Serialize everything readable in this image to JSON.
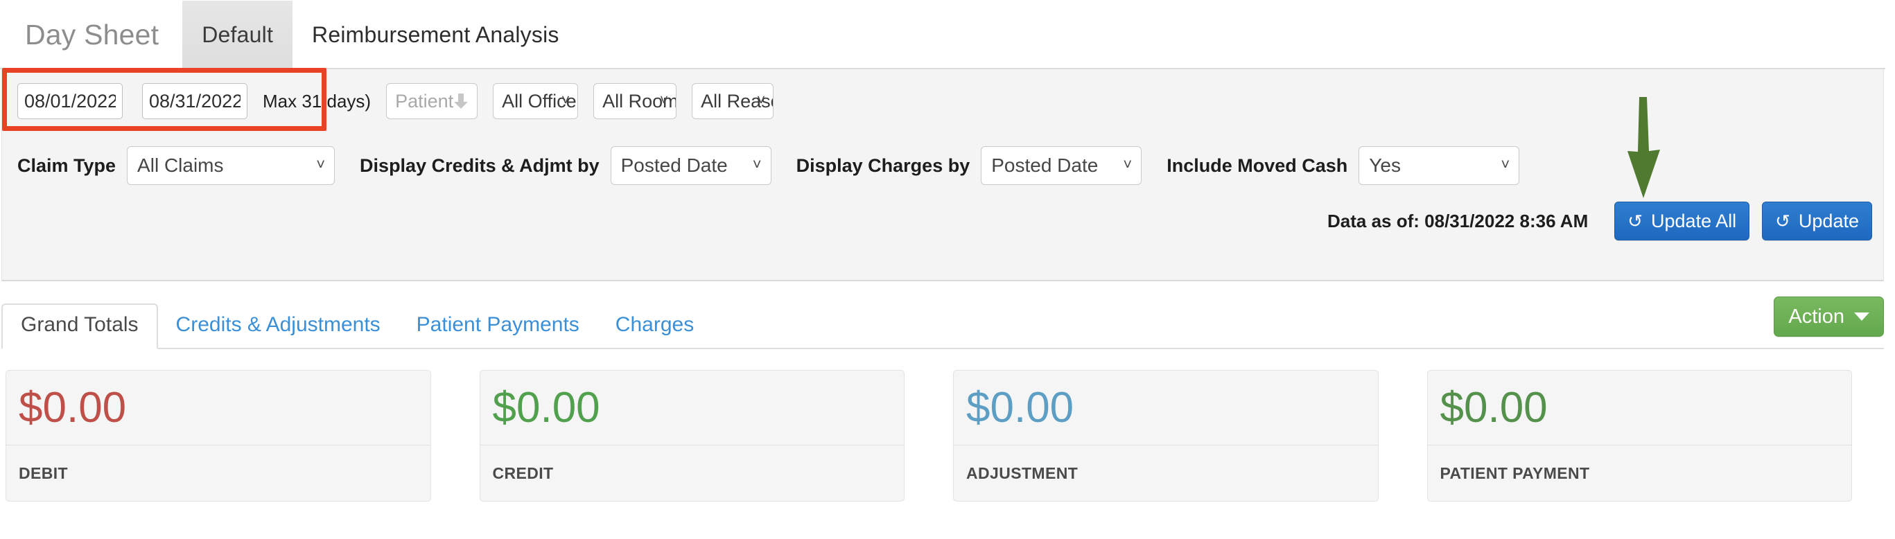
{
  "header": {
    "title": "Day Sheet",
    "tabs": [
      {
        "label": "Default",
        "active": true
      },
      {
        "label": "Reimbursement Analysis",
        "active": false
      }
    ]
  },
  "filters": {
    "date_from": "08/01/2022",
    "date_to": "08/31/2022",
    "max_days_note": "Max 31 days)",
    "patient_placeholder": "Patient",
    "office_value": "All Office",
    "room_value": "All Room",
    "reason_value": "All Reaso",
    "claim_type_label": "Claim Type",
    "claim_type_value": "All Claims",
    "display_credits_label": "Display Credits & Adjmt by",
    "display_credits_value": "Posted Date",
    "display_charges_label": "Display Charges by",
    "display_charges_value": "Posted Date",
    "include_moved_cash_label": "Include Moved Cash",
    "include_moved_cash_value": "Yes"
  },
  "actions": {
    "data_as_of": "Data as of: 08/31/2022 8:36 AM",
    "update_all_label": "Update All",
    "update_label": "Update",
    "refresh_icon": "refresh-icon",
    "action_label": "Action"
  },
  "content_tabs": [
    {
      "label": "Grand Totals",
      "active": true
    },
    {
      "label": "Credits & Adjustments",
      "active": false
    },
    {
      "label": "Patient Payments",
      "active": false
    },
    {
      "label": "Charges",
      "active": false
    }
  ],
  "cards": [
    {
      "value": "$0.00",
      "label": "DEBIT",
      "color": "#bf5049"
    },
    {
      "value": "$0.00",
      "label": "CREDIT",
      "color": "#51a04e"
    },
    {
      "value": "$0.00",
      "label": "ADJUSTMENT",
      "color": "#5d9ec4"
    },
    {
      "value": "$0.00",
      "label": "PATIENT PAYMENT",
      "color": "#54914b"
    }
  ],
  "annotations": {
    "highlight_color": "#ea4224",
    "arrow_color": "#4f7a2f"
  }
}
